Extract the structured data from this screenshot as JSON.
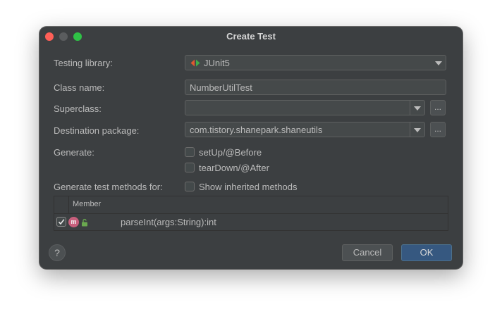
{
  "window": {
    "title": "Create Test"
  },
  "form": {
    "testing_library": {
      "label": "Testing library:",
      "value": "JUnit5"
    },
    "class_name": {
      "label": "Class name:",
      "value": "NumberUtilTest"
    },
    "superclass": {
      "label": "Superclass:",
      "value": "",
      "browse_label": "..."
    },
    "destination_package": {
      "label": "Destination package:",
      "value": "com.tistory.shanepark.shaneutils",
      "browse_label": "..."
    },
    "generate": {
      "label": "Generate:",
      "options": [
        {
          "label": "setUp/@Before",
          "checked": false
        },
        {
          "label": "tearDown/@After",
          "checked": false
        }
      ]
    },
    "generate_methods_for": {
      "label": "Generate test methods for:",
      "show_inherited": {
        "label": "Show inherited methods",
        "checked": false
      }
    }
  },
  "members_table": {
    "header": "Member",
    "rows": [
      {
        "checked": true,
        "icon_letter": "m",
        "signature": "parseInt(args:String):int"
      }
    ]
  },
  "buttons": {
    "help": "?",
    "cancel": "Cancel",
    "ok": "OK"
  },
  "colors": {
    "dialog_bg": "#3c3f41",
    "field_bg": "#45494a",
    "ok_button": "#365880",
    "method_icon": "#c75f7c",
    "library_icon_left": "#e0582f",
    "library_icon_right": "#3fae4a"
  },
  "icons": {
    "library": "junit-logo-icon",
    "method": "method-m-icon",
    "visibility": "public-lock-icon",
    "dropdown": "chevron-down-icon"
  }
}
